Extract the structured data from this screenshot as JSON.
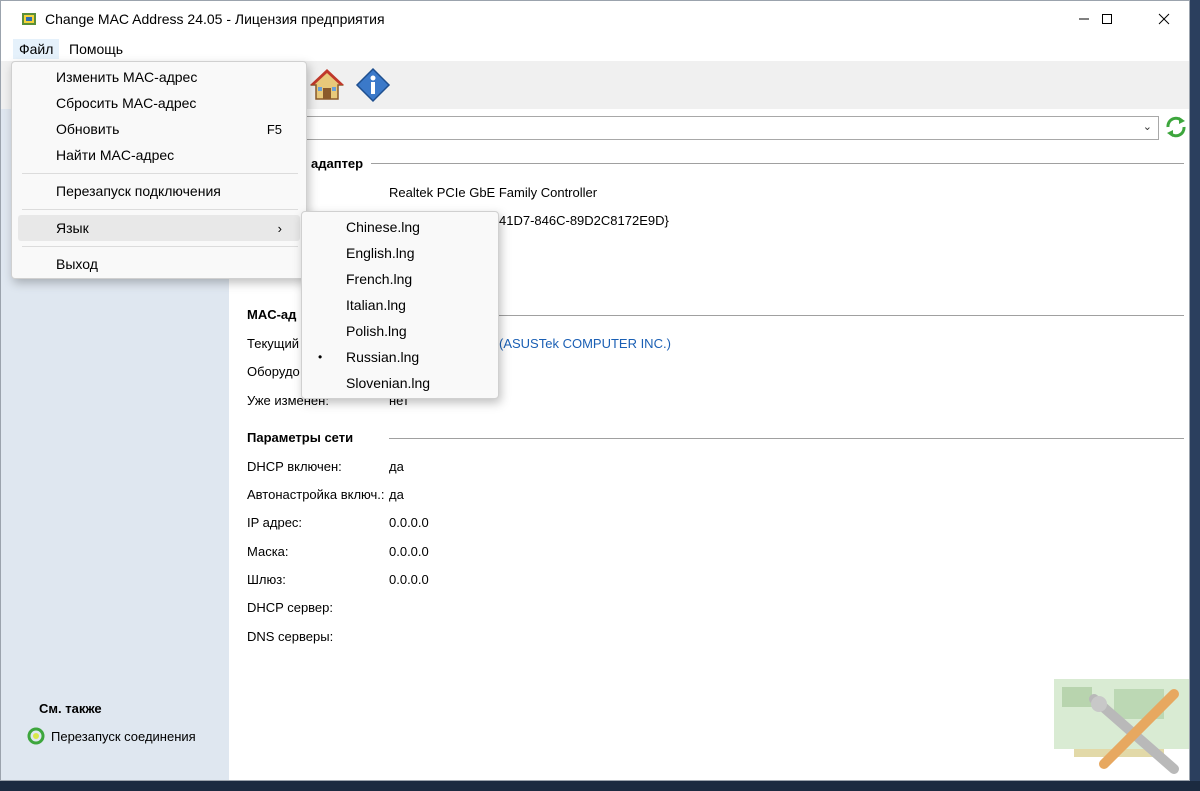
{
  "window": {
    "title": "Change MAC Address 24.05 - Лицензия предприятия",
    "minimize_glyph": "—",
    "maximize_glyph": "☐",
    "close_glyph": "✕"
  },
  "menubar": {
    "file": "Файл",
    "help": "Помощь"
  },
  "file_menu": {
    "items": [
      {
        "label": "Изменить MAC-адрес",
        "shortcut": ""
      },
      {
        "label": "Сбросить MAC-адрес",
        "shortcut": ""
      },
      {
        "label": "Обновить",
        "shortcut": "F5"
      },
      {
        "label": "Найти MAC-адрес",
        "shortcut": ""
      },
      {
        "label": "Перезапуск подключения",
        "shortcut": ""
      },
      {
        "label": "Язык",
        "shortcut": "›"
      },
      {
        "label": "Выход",
        "shortcut": ""
      }
    ]
  },
  "language_submenu": {
    "items": [
      {
        "label": "Chinese.lng",
        "selected": false
      },
      {
        "label": "English.lng",
        "selected": false
      },
      {
        "label": "French.lng",
        "selected": false
      },
      {
        "label": "Italian.lng",
        "selected": false
      },
      {
        "label": "Polish.lng",
        "selected": false
      },
      {
        "label": "Russian.lng",
        "selected": true
      },
      {
        "label": "Slovenian.lng",
        "selected": false
      }
    ],
    "bullet": "•"
  },
  "sidebar": {
    "see_also_title": "См. также",
    "restart_link": "Перезапуск соединения"
  },
  "main": {
    "adapter_section": "адаптер",
    "adapter_name": "Realtek PCIe GbE Family Controller",
    "adapter_guid_fragment": "41D7-846C-89D2C8172E9D}",
    "mac_section": "MAC-ад",
    "mac_current_label": "Текущий",
    "mac_current_vendor": "(ASUSTek COMPUTER INC.)",
    "mac_hardware_label": "Оборудо",
    "mac_changed_label": "Уже изменен:",
    "mac_changed_value": "нет",
    "network_section": "Параметры сети",
    "rows": [
      {
        "label": "DHCP включен:",
        "value": "да"
      },
      {
        "label": "Автонастройка включ.:",
        "value": "да"
      },
      {
        "label": "IP адрес:",
        "value": "0.0.0.0"
      },
      {
        "label": "Маска:",
        "value": "0.0.0.0"
      },
      {
        "label": "Шлюз:",
        "value": "0.0.0.0"
      },
      {
        "label": "DHCP сервер:",
        "value": ""
      },
      {
        "label": "DNS серверы:",
        "value": ""
      }
    ]
  },
  "colors": {
    "sidebar_bg": "#dfe7f0",
    "link": "#1a5fb4",
    "accent_green": "#3da63d"
  }
}
